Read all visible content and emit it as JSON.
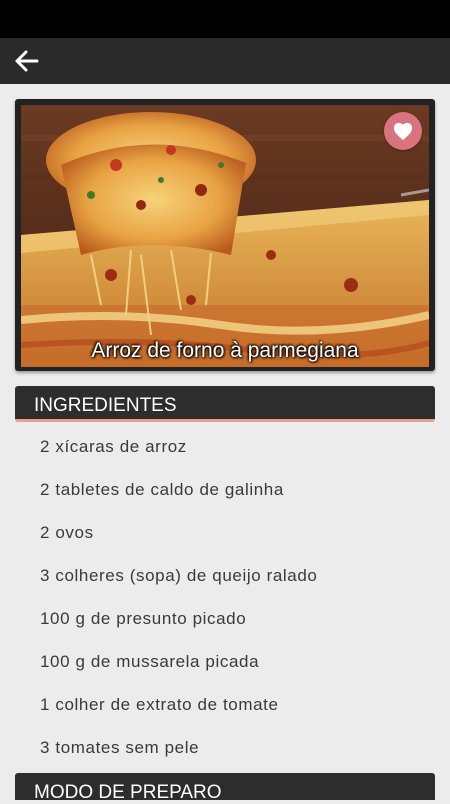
{
  "app_bar": {
    "back_icon": "arrow-left-icon"
  },
  "recipe": {
    "title": "Arroz de forno à parmegiana",
    "favorite_icon": "heart-icon",
    "accent_color": "#e7a08a",
    "favorite_color": "#d9737d"
  },
  "ingredients": {
    "header": "INGREDIENTES",
    "items": [
      "2 xícaras de arroz",
      "2 tabletes de caldo de galinha",
      "2 ovos",
      "3 colheres (sopa) de queijo ralado",
      "100 g de presunto picado",
      "100 g de mussarela picada",
      "1 colher de extrato de tomate",
      "3 tomates sem pele"
    ]
  },
  "preparation": {
    "header": "MODO DE PREPARO"
  }
}
